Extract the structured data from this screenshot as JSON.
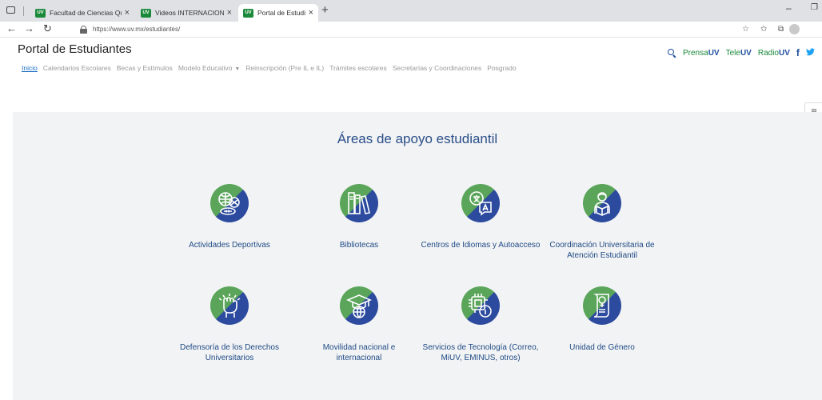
{
  "browser": {
    "tabs": [
      {
        "favicon": "UV",
        "title": "Facultad de Ciencias Químicas",
        "active": false
      },
      {
        "favicon": "UV",
        "title": "Videos INTERNACIONALIZACIÓN",
        "active": false
      },
      {
        "favicon": "UV",
        "title": "Portal de Estudiantes",
        "active": true
      }
    ],
    "new_tab": "+",
    "close_glyph": "×",
    "address": "https://www.uv.mx/estudiantes/",
    "icons": [
      "back-icon",
      "forward-icon",
      "refresh-icon",
      "lock-icon",
      "read-aloud-icon",
      "favorites-icon",
      "collections-icon",
      "profile-icon"
    ]
  },
  "site": {
    "title": "Portal de Estudiantes",
    "links": [
      {
        "light": "Prensa",
        "bold": "UV"
      },
      {
        "light": "Tele",
        "bold": "UV"
      },
      {
        "light": "Radio",
        "bold": "UV"
      }
    ],
    "facebook": "f",
    "twitter": "🐦"
  },
  "nav": [
    {
      "label": "Inicio",
      "active": true
    },
    {
      "label": "Calendarios Escolares"
    },
    {
      "label": "Becas y Estímulos"
    },
    {
      "label": "Modelo Educativo",
      "dropdown": true
    },
    {
      "label": "Reinscripción (Pre IL e IL)"
    },
    {
      "label": "Trámites escolares"
    },
    {
      "label": "Secretarías y Coordinaciones"
    },
    {
      "label": "Posgrado"
    }
  ],
  "main": {
    "title": "Áreas de apoyo estudiantil",
    "cards": [
      {
        "label": "Actividades Deportivas",
        "icon": "sports-balls-icon"
      },
      {
        "label": "Bibliotecas",
        "icon": "books-icon"
      },
      {
        "label": "Centros de Idiomas y Autoacceso",
        "icon": "language-chat-icon"
      },
      {
        "label": "Coordinación Universitaria de Atención Estudiantil",
        "icon": "student-reading-icon"
      },
      {
        "label": "Defensoría de los Derechos Universitarios",
        "icon": "raised-fist-icon"
      },
      {
        "label": "Movilidad nacional e internacional",
        "icon": "graduation-globe-icon"
      },
      {
        "label": "Servicios de Tecnología (Correo, MiUV, EMINUS, otros)",
        "icon": "chip-info-icon"
      },
      {
        "label": "Unidad de Género",
        "icon": "gender-document-icon"
      }
    ]
  },
  "colors": {
    "green": "#5aa55a",
    "blue": "#2c4a9e",
    "link": "#1a6fc4",
    "heading": "#2a4e8a"
  }
}
